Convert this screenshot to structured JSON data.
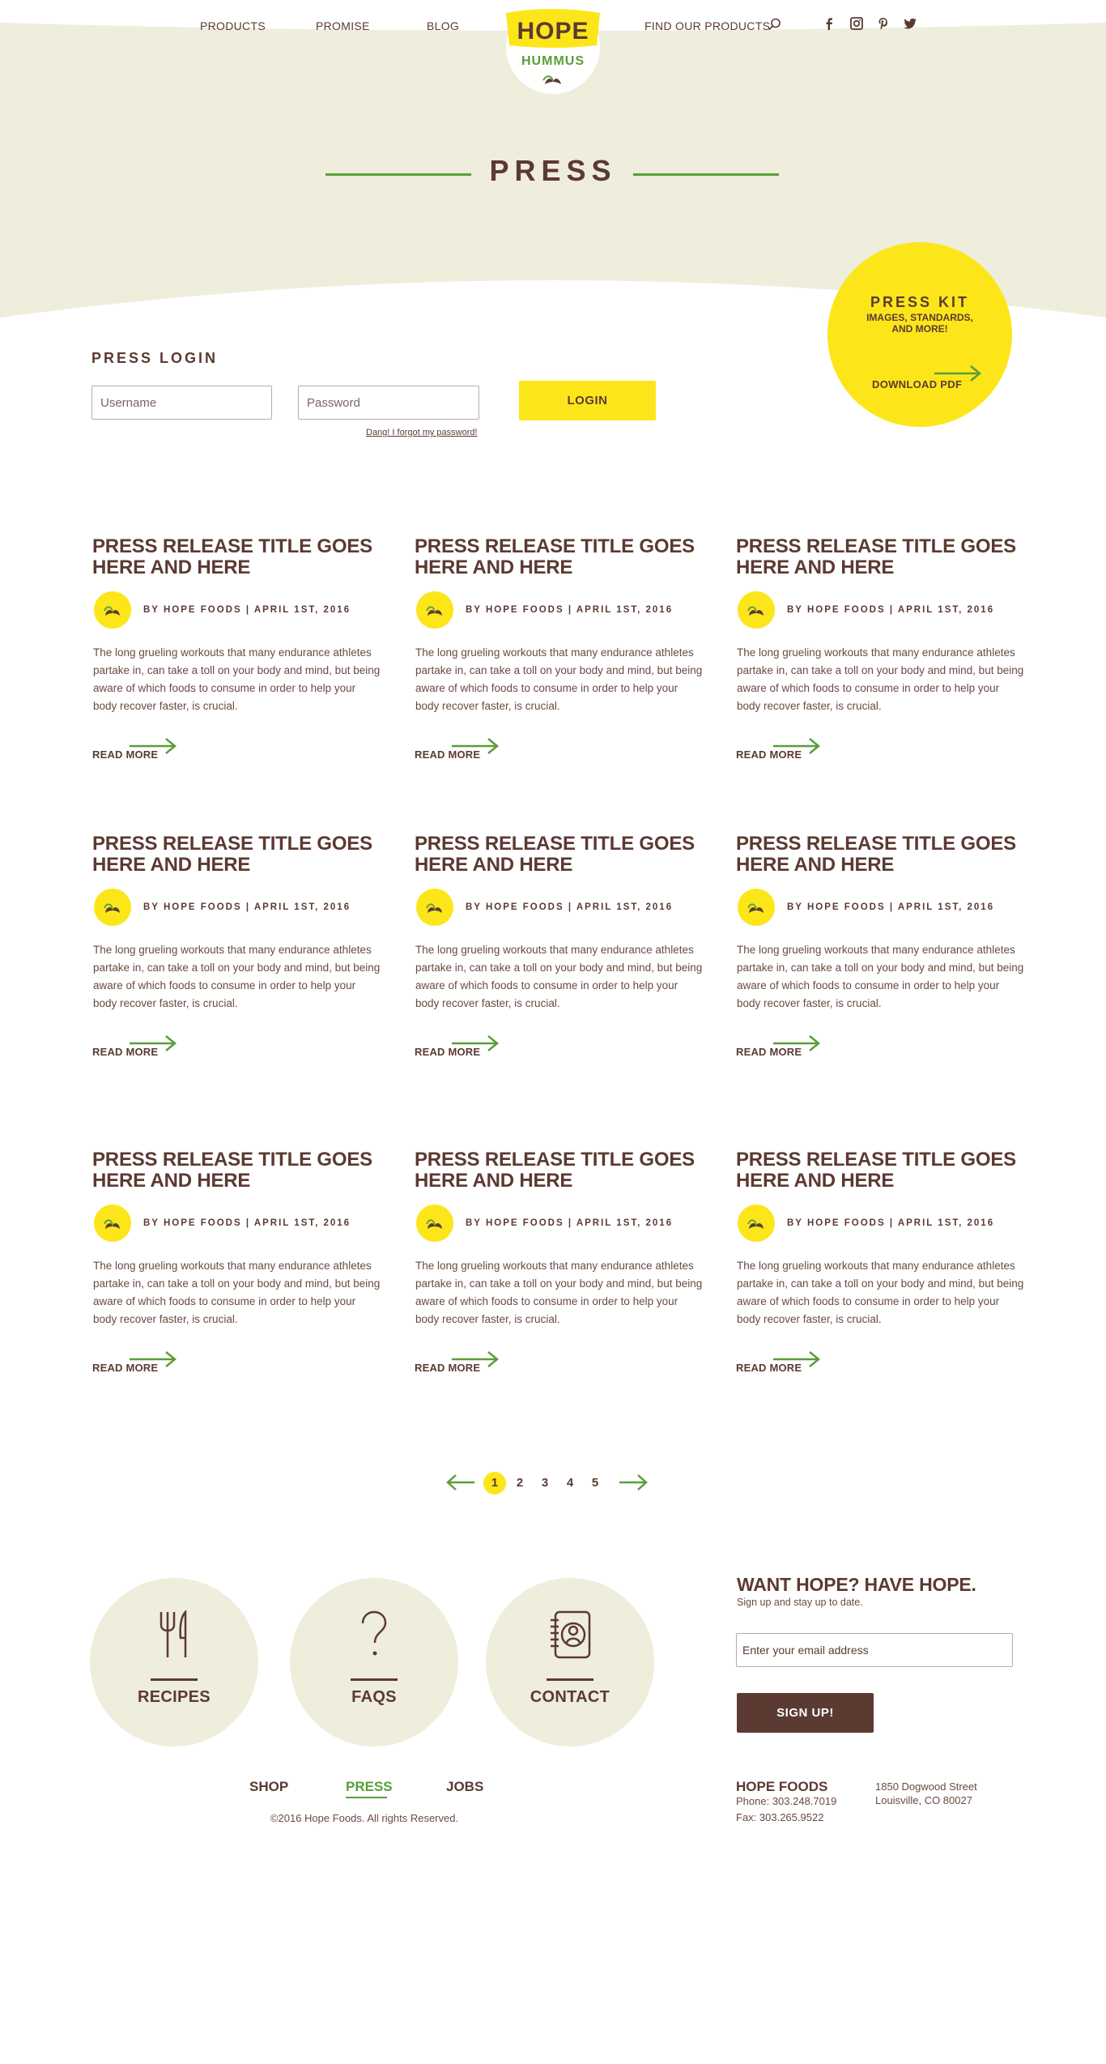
{
  "header": {
    "nav": [
      {
        "label": "PRODUCTS"
      },
      {
        "label": "PROMISE"
      },
      {
        "label": "BLOG"
      },
      {
        "label": "FIND OUR PRODUCTS"
      }
    ],
    "logo": {
      "top": "HOPE",
      "bottom": "HUMMUS"
    },
    "social": [
      "facebook-icon",
      "instagram-icon",
      "pinterest-icon",
      "twitter-icon"
    ]
  },
  "hero": {
    "title": "PRESS"
  },
  "press_kit": {
    "title": "PRESS KIT",
    "subtitle": "IMAGES, STANDARDS, AND MORE!",
    "download": "DOWNLOAD PDF"
  },
  "login": {
    "heading": "PRESS LOGIN",
    "username_placeholder": "Username",
    "password_placeholder": "Password",
    "button": "LOGIN",
    "forgot": "Dang! I forgot my password!"
  },
  "articles": [
    {
      "title": "PRESS RELEASE TITLE GOES HERE AND HERE",
      "byline": "BY HOPE FOODS | APRIL 1ST, 2016",
      "body": "The long grueling workouts that many endurance athletes partake in, can take a toll on your body and mind, but being aware of which foods to consume in order to help your body recover faster, is crucial.",
      "more": "READ MORE"
    },
    {
      "title": "PRESS RELEASE TITLE GOES HERE AND HERE",
      "byline": "BY HOPE FOODS | APRIL 1ST, 2016",
      "body": "The long grueling workouts that many endurance athletes partake in, can take a toll on your body and mind, but being aware of which foods to consume in order to help your body recover faster, is crucial.",
      "more": "READ MORE"
    },
    {
      "title": "PRESS RELEASE TITLE GOES HERE AND HERE",
      "byline": "BY HOPE FOODS | APRIL 1ST, 2016",
      "body": "The long grueling workouts that many endurance athletes partake in, can take a toll on your body and mind, but being aware of which foods to consume in order to help your body recover faster, is crucial.",
      "more": "READ MORE"
    },
    {
      "title": "PRESS RELEASE TITLE GOES HERE AND HERE",
      "byline": "BY HOPE FOODS | APRIL 1ST, 2016",
      "body": "The long grueling workouts that many endurance athletes partake in, can take a toll on your body and mind, but being aware of which foods to consume in order to help your body recover faster, is crucial.",
      "more": "READ MORE"
    },
    {
      "title": "PRESS RELEASE TITLE GOES HERE AND HERE",
      "byline": "BY HOPE FOODS | APRIL 1ST, 2016",
      "body": "The long grueling workouts that many endurance athletes partake in, can take a toll on your body and mind, but being aware of which foods to consume in order to help your body recover faster, is crucial.",
      "more": "READ MORE"
    },
    {
      "title": "PRESS RELEASE TITLE GOES HERE AND HERE",
      "byline": "BY HOPE FOODS | APRIL 1ST, 2016",
      "body": "The long grueling workouts that many endurance athletes partake in, can take a toll on your body and mind, but being aware of which foods to consume in order to help your body recover faster, is crucial.",
      "more": "READ MORE"
    },
    {
      "title": "PRESS RELEASE TITLE GOES HERE AND HERE",
      "byline": "BY HOPE FOODS | APRIL 1ST, 2016",
      "body": "The long grueling workouts that many endurance athletes partake in, can take a toll on your body and mind, but being aware of which foods to consume in order to help your body recover faster, is crucial.",
      "more": "READ MORE"
    },
    {
      "title": "PRESS RELEASE TITLE GOES HERE AND HERE",
      "byline": "BY HOPE FOODS | APRIL 1ST, 2016",
      "body": "The long grueling workouts that many endurance athletes partake in, can take a toll on your body and mind, but being aware of which foods to consume in order to help your body recover faster, is crucial.",
      "more": "READ MORE"
    },
    {
      "title": "PRESS RELEASE TITLE GOES HERE AND HERE",
      "byline": "BY HOPE FOODS | APRIL 1ST, 2016",
      "body": "The long grueling workouts that many endurance athletes partake in, can take a toll on your body and mind, but being aware of which foods to consume in order to help your body recover faster, is crucial.",
      "more": "READ MORE"
    }
  ],
  "pagination": {
    "pages": [
      "1",
      "2",
      "3",
      "4",
      "5"
    ],
    "current": "1"
  },
  "footer": {
    "circles": [
      {
        "label": "RECIPES",
        "icon": "fork-knife-icon"
      },
      {
        "label": "FAQS",
        "icon": "question-mark-icon"
      },
      {
        "label": "CONTACT",
        "icon": "address-book-icon"
      }
    ],
    "subscribe": {
      "heading": "WANT HOPE? HAVE HOPE.",
      "desc": "Sign up and stay up to date.",
      "placeholder": "Enter your email address",
      "button": "SIGN UP!"
    },
    "links": [
      "SHOP",
      "PRESS",
      "JOBS"
    ],
    "copyright": "©2016 Hope Foods. All rights Reserved.",
    "company": {
      "name": "HOPE FOODS",
      "phone": "Phone: 303.248.7019",
      "fax": "Fax: 303.265.9522",
      "address1": "1850 Dogwood Street",
      "address2": "Louisville, CO 80027"
    }
  },
  "colors": {
    "brown": "#5b3a32",
    "yellow": "#fce61a",
    "green": "#5a9e3a",
    "cream": "#efeddb"
  }
}
